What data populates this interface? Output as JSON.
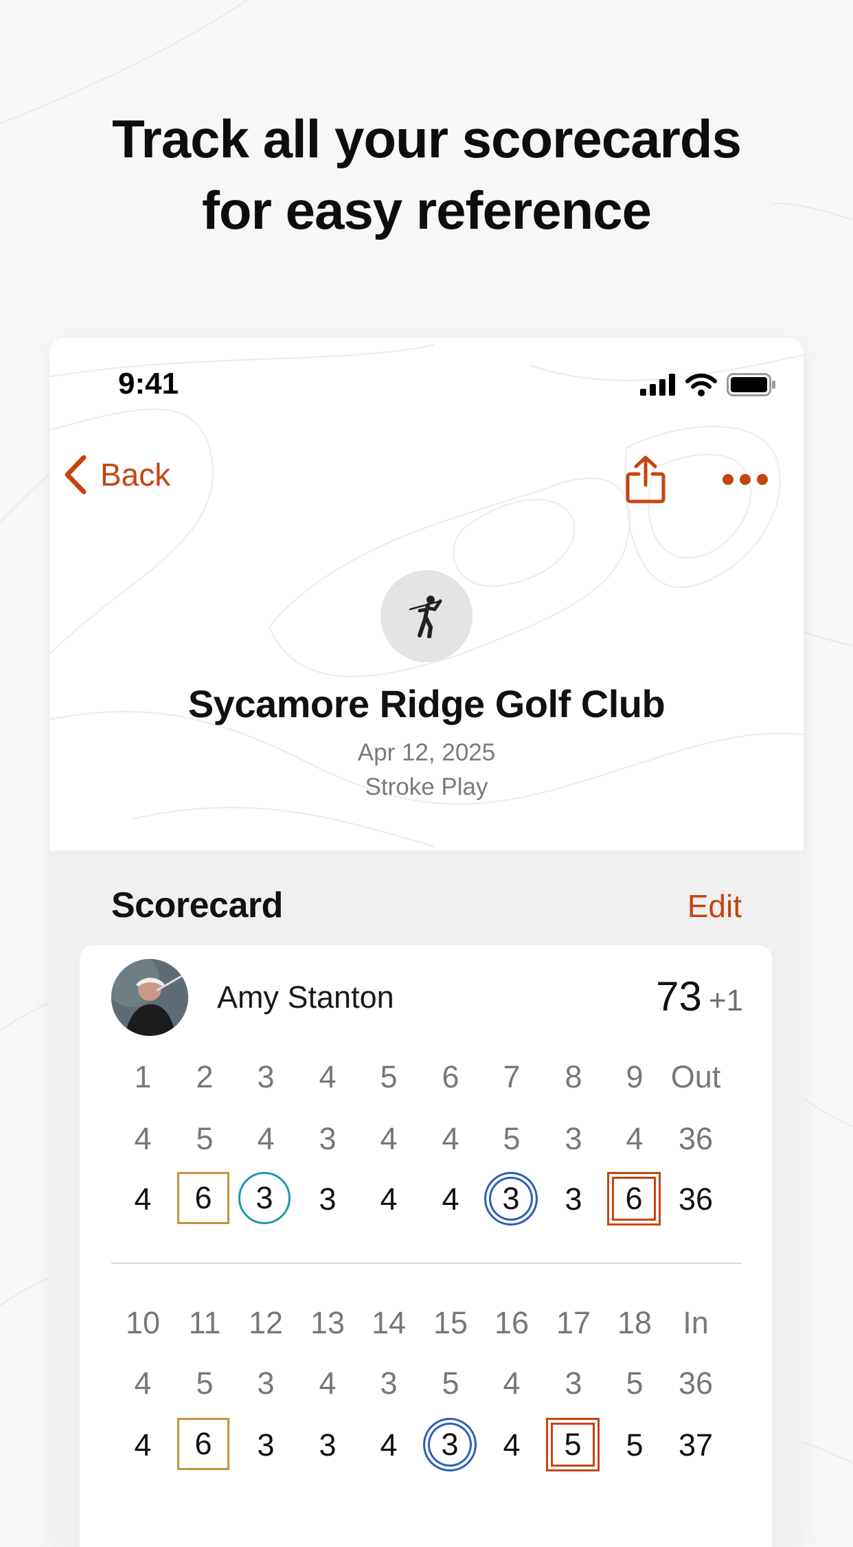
{
  "headline": {
    "line1": "Track all your scorecards",
    "line2": "for easy reference"
  },
  "status_bar": {
    "time": "9:41",
    "icons": [
      "signal-icon",
      "wifi-icon",
      "battery-icon"
    ]
  },
  "nav": {
    "back_label": "Back",
    "share_icon": "share-icon",
    "more_icon": "more-icon"
  },
  "course": {
    "icon": "golfer-icon",
    "name": "Sycamore Ridge Golf Club",
    "date": "Apr 12, 2025",
    "format": "Stroke Play"
  },
  "scorecard": {
    "title": "Scorecard",
    "edit_label": "Edit",
    "player": {
      "name": "Amy Stanton",
      "total": "73",
      "relative": "+1"
    },
    "front": {
      "holes": [
        "1",
        "2",
        "3",
        "4",
        "5",
        "6",
        "7",
        "8",
        "9",
        "Out"
      ],
      "par": [
        "4",
        "5",
        "4",
        "3",
        "4",
        "4",
        "5",
        "3",
        "4",
        "36"
      ],
      "scores": [
        "4",
        "6",
        "3",
        "3",
        "4",
        "4",
        "3",
        "3",
        "6",
        "36"
      ],
      "marks": [
        "none",
        "bogey",
        "birdie",
        "none",
        "none",
        "none",
        "eagle",
        "none",
        "double",
        "none"
      ]
    },
    "back": {
      "holes": [
        "10",
        "11",
        "12",
        "13",
        "14",
        "15",
        "16",
        "17",
        "18",
        "In"
      ],
      "par": [
        "4",
        "5",
        "3",
        "4",
        "3",
        "5",
        "4",
        "3",
        "5",
        "36"
      ],
      "scores": [
        "4",
        "6",
        "3",
        "3",
        "4",
        "3",
        "4",
        "5",
        "5",
        "37"
      ],
      "marks": [
        "none",
        "bogey",
        "none",
        "none",
        "none",
        "eagle",
        "none",
        "double",
        "none",
        "none"
      ]
    }
  },
  "colors": {
    "accent": "#c4450f",
    "bogey": "#c8913d",
    "birdie": "#1c99a8",
    "eagle": "#2c5fb4"
  }
}
